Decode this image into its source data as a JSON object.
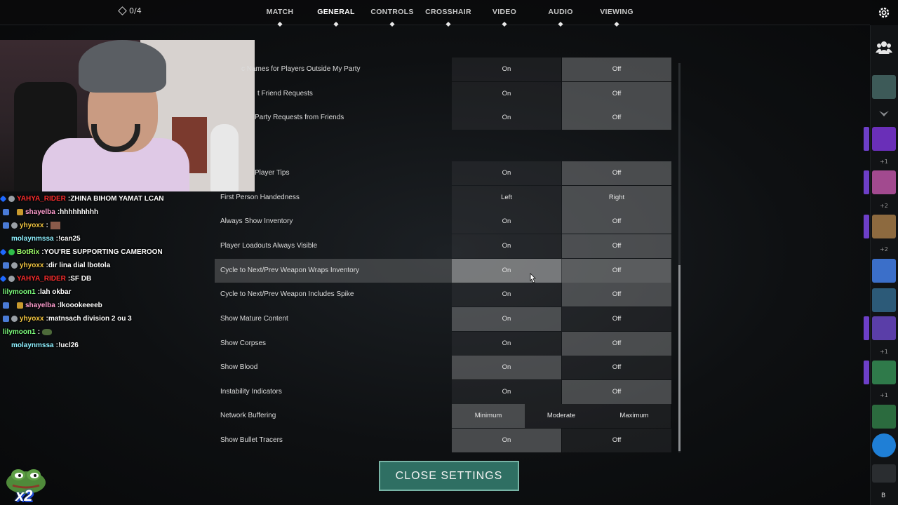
{
  "topnav": {
    "tokens": "0/4",
    "tabs": [
      {
        "label": "MATCH"
      },
      {
        "label": "GENERAL"
      },
      {
        "label": "CONTROLS"
      },
      {
        "label": "CROSSHAIR"
      },
      {
        "label": "VIDEO"
      },
      {
        "label": "AUDIO"
      },
      {
        "label": "VIEWING"
      }
    ],
    "active_tab": "GENERAL"
  },
  "settings_rows": [
    {
      "label": "c Names for Players Outside My Party",
      "on": "On",
      "off": "Off",
      "selected": "Off"
    },
    {
      "label": "t Friend Requests",
      "on": "On",
      "off": "Off",
      "selected": "Off"
    },
    {
      "label": "Party Requests from Friends",
      "on": "On",
      "off": "Off",
      "selected": "Off"
    },
    {
      "label": "Player Tips",
      "on": "On",
      "off": "Off",
      "selected": "Off"
    },
    {
      "label": "First Person Handedness",
      "on": "Left",
      "off": "Right",
      "selected": "Right"
    },
    {
      "label": "Always Show Inventory",
      "on": "On",
      "off": "Off",
      "selected": "Off"
    },
    {
      "label": "Player Loadouts Always Visible",
      "on": "On",
      "off": "Off",
      "selected": "Off"
    },
    {
      "label": "Cycle to Next/Prev Weapon Wraps Inventory",
      "on": "On",
      "off": "Off",
      "selected": "On"
    },
    {
      "label": "Cycle to Next/Prev Weapon Includes Spike",
      "on": "On",
      "off": "Off",
      "selected": "Off"
    },
    {
      "label": "Show Mature Content",
      "on": "On",
      "off": "Off",
      "selected": "On"
    },
    {
      "label": "Show Corpses",
      "on": "On",
      "off": "Off",
      "selected": "Off"
    },
    {
      "label": "Show Blood",
      "on": "On",
      "off": "Off",
      "selected": "On"
    },
    {
      "label": "Instability Indicators",
      "on": "On",
      "off": "Off",
      "selected": "Off"
    },
    {
      "label": "Network Buffering",
      "options": [
        "Minimum",
        "Moderate",
        "Maximum"
      ],
      "selected": "Minimum"
    },
    {
      "label": "Show Bullet Tracers",
      "on": "On",
      "off": "Off",
      "selected": "On"
    }
  ],
  "close_button": "CLOSE SETTINGS",
  "chat": [
    {
      "user": "YAHYA_RIDER",
      "color": "#ff2e2e",
      "msg": "ZHINA BIHOM YAMAT LCAN"
    },
    {
      "user": "shayelba",
      "color": "#ff9ecf",
      "msg": "hhhhhhhhh"
    },
    {
      "user": "yhyoxx",
      "color": "#f5c842",
      "msg": ""
    },
    {
      "user": "molaynmssa",
      "color": "#8ef0ff",
      "msg": "!can25"
    },
    {
      "user": "BotRix",
      "color": "#9eff6b",
      "msg": "YOU'RE SUPPORTING CAMEROON"
    },
    {
      "user": "yhyoxx",
      "color": "#f5c842",
      "msg": "dir lina dial lbotola"
    },
    {
      "user": "YAHYA_RIDER",
      "color": "#ff2e2e",
      "msg": "SF DB"
    },
    {
      "user": "lilymoon1",
      "color": "#7dff7d",
      "msg": "lah okbar"
    },
    {
      "user": "shayelba",
      "color": "#ff9ecf",
      "msg": "lkoookeeeeb"
    },
    {
      "user": "yhyoxx",
      "color": "#f5c842",
      "msg": "matnsach division 2 ou 3"
    },
    {
      "user": "lilymoon1",
      "color": "#7dff7d",
      "msg": ""
    },
    {
      "user": "molaynmssa",
      "color": "#8ef0ff",
      "msg": "!ucl26"
    }
  ],
  "emote_overlay": "x2",
  "rail": {
    "plus_labels": [
      "+1",
      "+2",
      "+2",
      "+1",
      "+1"
    ],
    "bottom_label": "B"
  }
}
